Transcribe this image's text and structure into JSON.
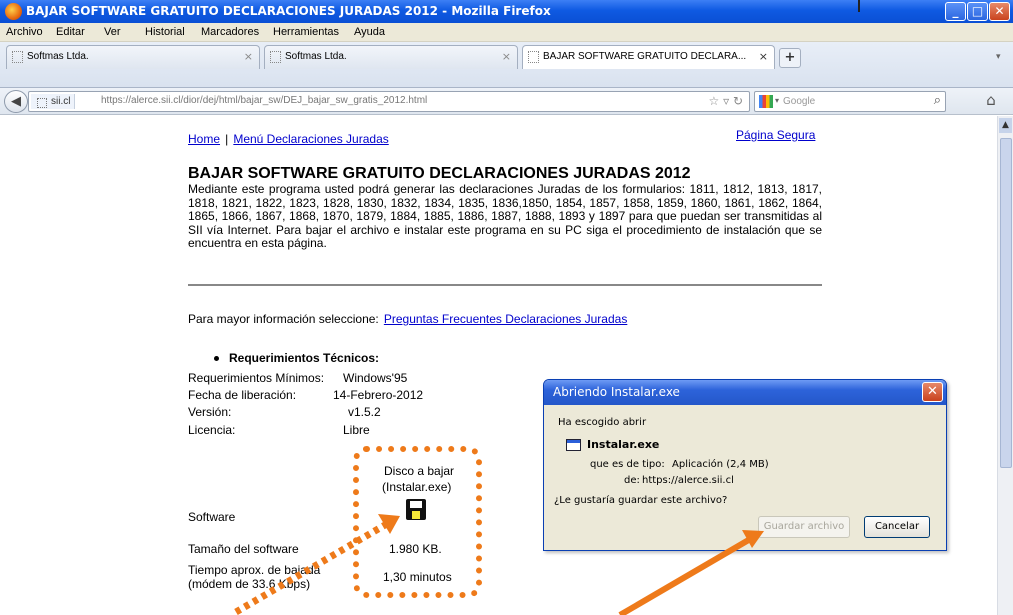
{
  "window": {
    "title": "BAJAR SOFTWARE GRATUITO DECLARACIONES JURADAS 2012 - Mozilla Firefox"
  },
  "menu": [
    "Archivo",
    "Editar",
    "Ver",
    "Historial",
    "Marcadores",
    "Herramientas",
    "Ayuda"
  ],
  "tabs": [
    {
      "label": "Softmas Ltda.",
      "close": "×"
    },
    {
      "label": "Softmas Ltda.",
      "close": "×"
    },
    {
      "label": "BAJAR SOFTWARE GRATUITO DECLARA...",
      "close": "×"
    }
  ],
  "newtab": "+",
  "nav": {
    "site": "sii.cl",
    "url": "https://alerce.sii.cl/dior/dej/html/bajar_sw/DEJ_bajar_sw_gratis_2012.html",
    "search_placeholder": "Google"
  },
  "page": {
    "links_top": {
      "home": "Home",
      "sep": "|",
      "menu": "Menú Declaraciones Juradas",
      "secure": "Página Segura"
    },
    "title": "BAJAR SOFTWARE GRATUITO DECLARACIONES JURADAS 2012",
    "description": "Mediante este programa usted podrá generar las declaraciones Juradas de los formularios: 1811, 1812, 1813, 1817, 1818, 1821, 1822, 1823, 1828, 1830, 1832, 1834, 1835, 1836,1850, 1854, 1857, 1858, 1859, 1860, 1861, 1862, 1864, 1865, 1866, 1867, 1868, 1870, 1879, 1884, 1885, 1886, 1887, 1888, 1893 y 1897 para que puedan ser transmitidas al SII vía Internet. Para bajar el archivo e instalar este programa en su PC siga el procedimiento de instalación que se encuentra en esta página.",
    "info_text": "Para mayor información seleccione:",
    "info_link": "Preguntas Frecuentes Declaraciones Juradas",
    "req_title": "Requerimientos Técnicos:",
    "req": [
      {
        "label": "Requerimientos Mínimos:",
        "value": "Windows'95"
      },
      {
        "label": "Fecha de liberación:",
        "value": "14-Febrero-2012"
      },
      {
        "label": "Versión:",
        "value": "v1.5.2"
      },
      {
        "label": "Licencia:",
        "value": "Libre"
      }
    ],
    "disk_line1": "Disco a bajar",
    "disk_line2": "(Instalar.exe)",
    "software_label": "Software",
    "size_label": "Tamaño del software",
    "size_value": "1.980 KB.",
    "time_label1": "Tiempo aprox. de bajada",
    "time_label2": "(módem de 33.6 Kbps)",
    "time_value": "1,30 minutos"
  },
  "dialog": {
    "title": "Abriendo Instalar.exe",
    "intro": "Ha escogido abrir",
    "filename": "Instalar.exe",
    "type_label": "que es de tipo:",
    "type_value": "Aplicación (2,4 MB)",
    "from_label": "de:",
    "from_value": "https://alerce.sii.cl",
    "question": "¿Le gustaría guardar este archivo?",
    "save": "Guardar archivo",
    "cancel": "Cancelar"
  },
  "colors": {
    "annotation": "#ee7a1a",
    "link": "#0000cc",
    "titlebar": "#0a4fd4"
  }
}
